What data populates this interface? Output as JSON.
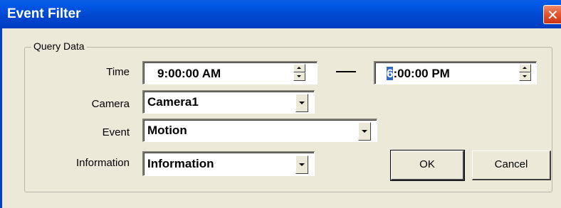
{
  "window": {
    "title": "Event Filter",
    "close_glyph": "✕"
  },
  "group": {
    "legend": "Query Data"
  },
  "time": {
    "label": "Time",
    "start_value": "9:00:00 AM",
    "end_value_selected": "6",
    "end_value_rest": ":00:00 PM"
  },
  "camera": {
    "label": "Camera",
    "value": "Camera1"
  },
  "event": {
    "label": "Event",
    "value": "Motion"
  },
  "information": {
    "label": "Information",
    "value": "Information"
  },
  "buttons": {
    "ok": "OK",
    "cancel": "Cancel"
  },
  "colors": {
    "titlebar": "#0054e3",
    "close": "#e5532b",
    "dialog_bg": "#ece9d8",
    "selection": "#316ac5"
  }
}
